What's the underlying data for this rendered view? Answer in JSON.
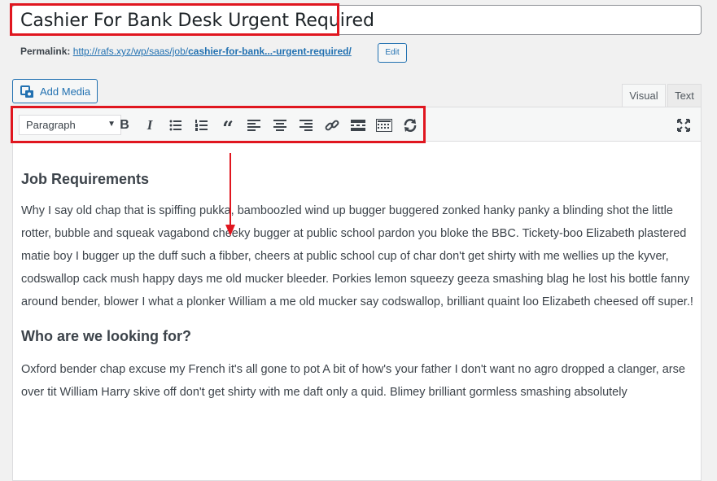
{
  "post": {
    "title": "Cashier For Bank Desk Urgent Required"
  },
  "permalink": {
    "label": "Permalink:",
    "url_prefix": "http://rafs.xyz/wp/saas/job/",
    "slug": "cashier-for-bank...-urgent-required/",
    "edit_label": "Edit"
  },
  "media": {
    "add_media_label": "Add Media"
  },
  "tabs": {
    "visual": "Visual",
    "text": "Text"
  },
  "toolbar": {
    "format_value": "Paragraph",
    "icons": [
      "bold-icon",
      "italic-icon",
      "bulleted-list-icon",
      "numbered-list-icon",
      "blockquote-icon",
      "align-left-icon",
      "align-center-icon",
      "align-right-icon",
      "link-icon",
      "read-more-icon",
      "toolbar-toggle-icon",
      "refresh-icon",
      "fullscreen-icon"
    ]
  },
  "content": {
    "heading1": "Job Requirements",
    "para1": "Why I say old chap that is spiffing pukka, bamboozled wind up bugger buggered zonked hanky panky a blinding shot the little rotter, bubble and squeak vagabond cheeky bugger at public school pardon you bloke the BBC. Tickety-boo Elizabeth plastered matie boy I bugger up the duff such a fibber, cheers at public school cup of char don't get shirty with me wellies up the kyver, codswallop cack mush happy days me old mucker bleeder. Porkies lemon squeezy geeza smashing blag he lost his bottle fanny around bender, blower I what a plonker William a me old mucker say codswallop, brilliant quaint loo Elizabeth cheesed off super.!",
    "heading2": "Who are we looking for?",
    "para2": "Oxford bender chap excuse my French it's all gone to pot A bit of how's your father I don't want no agro dropped a clanger, arse over tit William Harry skive off don't get shirty with me daft only a quid. Blimey brilliant gormless smashing absolutely"
  },
  "colors": {
    "highlight": "#e0161f",
    "link": "#2271b1"
  }
}
